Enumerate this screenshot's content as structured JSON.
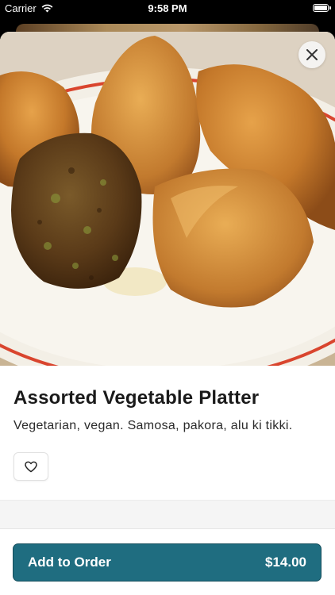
{
  "status_bar": {
    "carrier": "Carrier",
    "time": "9:58 PM"
  },
  "item": {
    "title": "Assorted Vegetable Platter",
    "description": "Vegetarian, vegan. Samosa, pakora, alu ki tikki."
  },
  "order_button": {
    "label": "Add to Order",
    "price": "$14.00"
  },
  "colors": {
    "accent": "#1f6d80",
    "plate_rim": "#d9452e"
  },
  "icons": {
    "close": "close-icon",
    "favorite": "heart-icon",
    "wifi": "wifi-icon",
    "battery": "battery-icon"
  }
}
